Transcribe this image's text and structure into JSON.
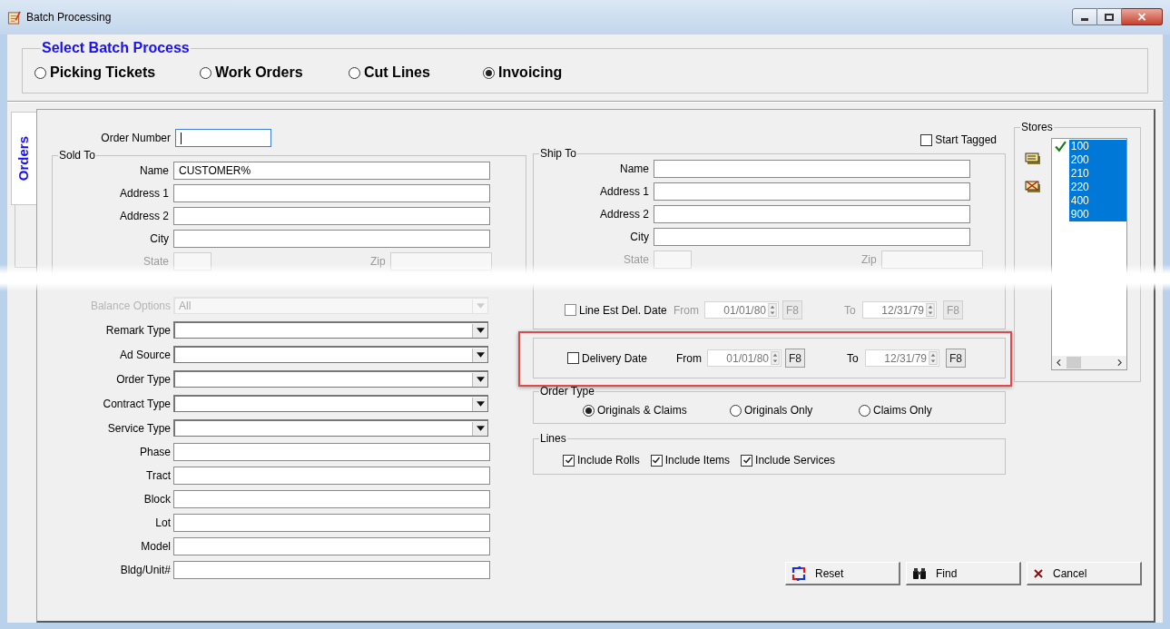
{
  "window": {
    "title": "Batch Processing"
  },
  "batch_process": {
    "legend": "Select Batch Process",
    "options": [
      {
        "label": "Picking Tickets",
        "selected": false
      },
      {
        "label": "Work Orders",
        "selected": false
      },
      {
        "label": "Cut Lines",
        "selected": false
      },
      {
        "label": "Invoicing",
        "selected": true
      }
    ]
  },
  "tabs": [
    {
      "label": "Orders",
      "selected": true
    },
    {
      "selected": false
    }
  ],
  "order_number": {
    "label": "Order Number",
    "focused": true
  },
  "sold_to": {
    "legend": "Sold To",
    "fields": [
      {
        "label": "Name",
        "value": "CUSTOMER%"
      },
      {
        "label": "Address 1"
      },
      {
        "label": "Address 2"
      },
      {
        "label": "City"
      }
    ],
    "state": {
      "label": "State",
      "disabled": true
    },
    "zip": {
      "label": "Zip",
      "disabled": true
    }
  },
  "filters": [
    {
      "kind": "select",
      "label": "Balance Options",
      "value": "All",
      "disabled": true
    },
    {
      "kind": "select",
      "label": "Remark Type",
      "disabled": false
    },
    {
      "kind": "select",
      "label": "Ad Source",
      "disabled": false
    },
    {
      "kind": "select",
      "label": "Order Type",
      "disabled": false
    },
    {
      "kind": "select",
      "label": "Contract Type",
      "disabled": false
    },
    {
      "kind": "select",
      "label": "Service Type",
      "disabled": false
    },
    {
      "kind": "text",
      "label": "Phase",
      "disabled": false
    },
    {
      "kind": "text",
      "label": "Tract",
      "disabled": false
    },
    {
      "kind": "text",
      "label": "Block",
      "disabled": false
    },
    {
      "kind": "text",
      "label": "Lot",
      "disabled": false
    },
    {
      "kind": "text",
      "label": "Model",
      "disabled": false
    },
    {
      "kind": "text",
      "label": "Bldg/Unit#",
      "disabled": false
    }
  ],
  "start_tagged": {
    "label": "Start Tagged",
    "checked": false
  },
  "ship_to": {
    "legend": "Ship To",
    "fields": [
      {
        "label": "Name"
      },
      {
        "label": "Address 1"
      },
      {
        "label": "Address 2"
      },
      {
        "label": "City"
      }
    ],
    "state": {
      "label": "State",
      "disabled": true
    },
    "zip": {
      "label": "Zip",
      "disabled": true
    },
    "line_est": {
      "label": "Line Est Del. Date",
      "checked": false,
      "disabled": true,
      "from_label": "From",
      "from_value": "01/01/80",
      "from_button": "F8",
      "to_label": "To",
      "to_value": "12/31/79",
      "to_button": "F8"
    }
  },
  "delivery_date": {
    "label": "Delivery Date",
    "checked": false,
    "disabled": false,
    "highlighted": true,
    "from_label": "From",
    "from_value": "01/01/80",
    "from_button": "F8",
    "to_label": "To",
    "to_value": "12/31/79",
    "to_button": "F8"
  },
  "order_type": {
    "legend": "Order Type",
    "options": [
      {
        "label": "Originals & Claims",
        "selected": true
      },
      {
        "label": "Originals Only",
        "selected": false
      },
      {
        "label": "Claims Only",
        "selected": false
      }
    ]
  },
  "lines": {
    "legend": "Lines",
    "options": [
      {
        "label": "Include Rolls",
        "checked": true
      },
      {
        "label": "Include Items",
        "checked": true
      },
      {
        "label": "Include Services",
        "checked": true
      }
    ]
  },
  "stores": {
    "legend": "Stores",
    "items": [
      {
        "label": "100",
        "selected": true,
        "checked": true
      },
      {
        "label": "200",
        "selected": true,
        "checked": false
      },
      {
        "label": "210",
        "selected": true,
        "checked": false
      },
      {
        "label": "220",
        "selected": true,
        "checked": false
      },
      {
        "label": "400",
        "selected": true,
        "checked": false
      },
      {
        "label": "900",
        "selected": true,
        "checked": false
      }
    ]
  },
  "buttons": [
    {
      "kind": "reset",
      "label": "Reset"
    },
    {
      "kind": "find",
      "label": "Find"
    },
    {
      "kind": "cancel",
      "label": "Cancel"
    }
  ]
}
